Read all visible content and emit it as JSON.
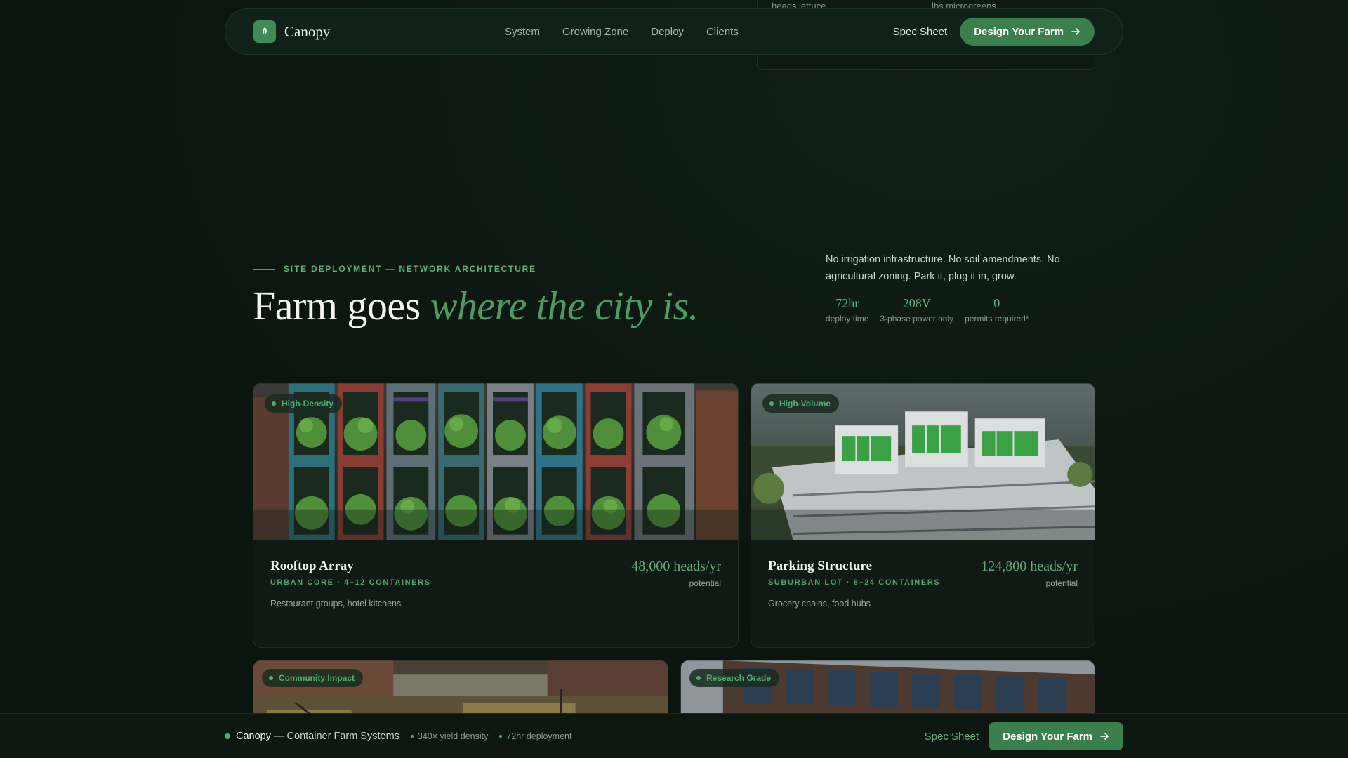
{
  "ghost_card": {
    "label_1": "heads lettuce",
    "label_2": "lbs microgreens"
  },
  "nav": {
    "brand": "Canopy",
    "links": [
      "System",
      "Growing Zone",
      "Deploy",
      "Clients"
    ],
    "spec_sheet": "Spec Sheet",
    "cta": "Design Your Farm"
  },
  "hero": {
    "eyebrow": "SITE DEPLOYMENT — NETWORK ARCHITECTURE",
    "headline_plain": "Farm goes ",
    "headline_accent": "where the city is.",
    "intro": "No irrigation infrastructure. No soil amendments. No agricultural zoning. Park it, plug it in, grow.",
    "stats": [
      {
        "value": "72hr",
        "label": "deploy time"
      },
      {
        "value": "208V",
        "label": "3-phase power only"
      },
      {
        "value": "0",
        "label": "permits required*"
      }
    ]
  },
  "cards": [
    {
      "badge": "High-Density",
      "title": "Rooftop Array",
      "meta": "URBAN CORE · 4–12 CONTAINERS",
      "desc": "Restaurant groups, hotel kitchens",
      "yield": "48,000 heads/yr",
      "yield_label": "potential"
    },
    {
      "badge": "High-Volume",
      "title": "Parking Structure",
      "meta": "SUBURBAN LOT · 8–24 CONTAINERS",
      "desc": "Grocery chains, food hubs",
      "yield": "124,800 heads/yr",
      "yield_label": "potential"
    },
    {
      "badge": "Community Impact"
    },
    {
      "badge": "Research Grade"
    }
  ],
  "bottom_bar": {
    "brand": "Canopy",
    "tagline": " — Container Farm Systems",
    "features": [
      "340× yield density",
      "72hr deployment"
    ],
    "spec_sheet": "Spec Sheet",
    "cta": "Design Your Farm"
  },
  "colors": {
    "accent": "#3b7f4d",
    "accent_text": "#5fae78",
    "background": "#0b150f"
  }
}
